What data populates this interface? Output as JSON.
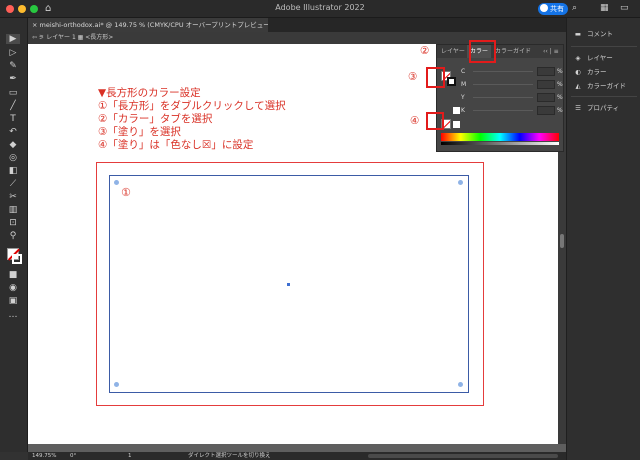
{
  "window": {
    "title": "Adobe Illustrator 2022",
    "share_label": "共有"
  },
  "document": {
    "tab_label": "× meishi-orthodox.ai* @ 149.75 % (CMYK/CPU オーバープリントプレビュー)",
    "breadcrumb": "⇦ ⚞ レイヤー 1  ▦ <長方形>",
    "zoom": "149.75%",
    "rotation": "0°",
    "page": "1",
    "status_text": "ダイレクト選択ツールを切り換え"
  },
  "instructions": {
    "lines": "▼長方形のカラー設定\n①「長方形」をダブルクリックして選択\n②「カラー」タブを選択\n③「塗り」を選択\n④「塗り」は「色なし☒」に設定"
  },
  "callouts": {
    "n1": "①",
    "n2": "②",
    "n3": "③",
    "n4": "④"
  },
  "color_panel": {
    "tabs": [
      "レイヤー",
      "カラー",
      "カラーガイド"
    ],
    "active_tab": "カラー",
    "menu_glyph": "‹‹ | ≡",
    "channels": [
      "C",
      "M",
      "Y",
      "K"
    ],
    "percent": "%"
  },
  "dock": {
    "items": [
      "コメント",
      "レイヤー",
      "カラー",
      "カラーガイド",
      "プロパティ"
    ]
  },
  "colors": {
    "accent_red": "#d93025",
    "selection_blue": "#3b5ba6",
    "share_blue": "#1473e6"
  }
}
